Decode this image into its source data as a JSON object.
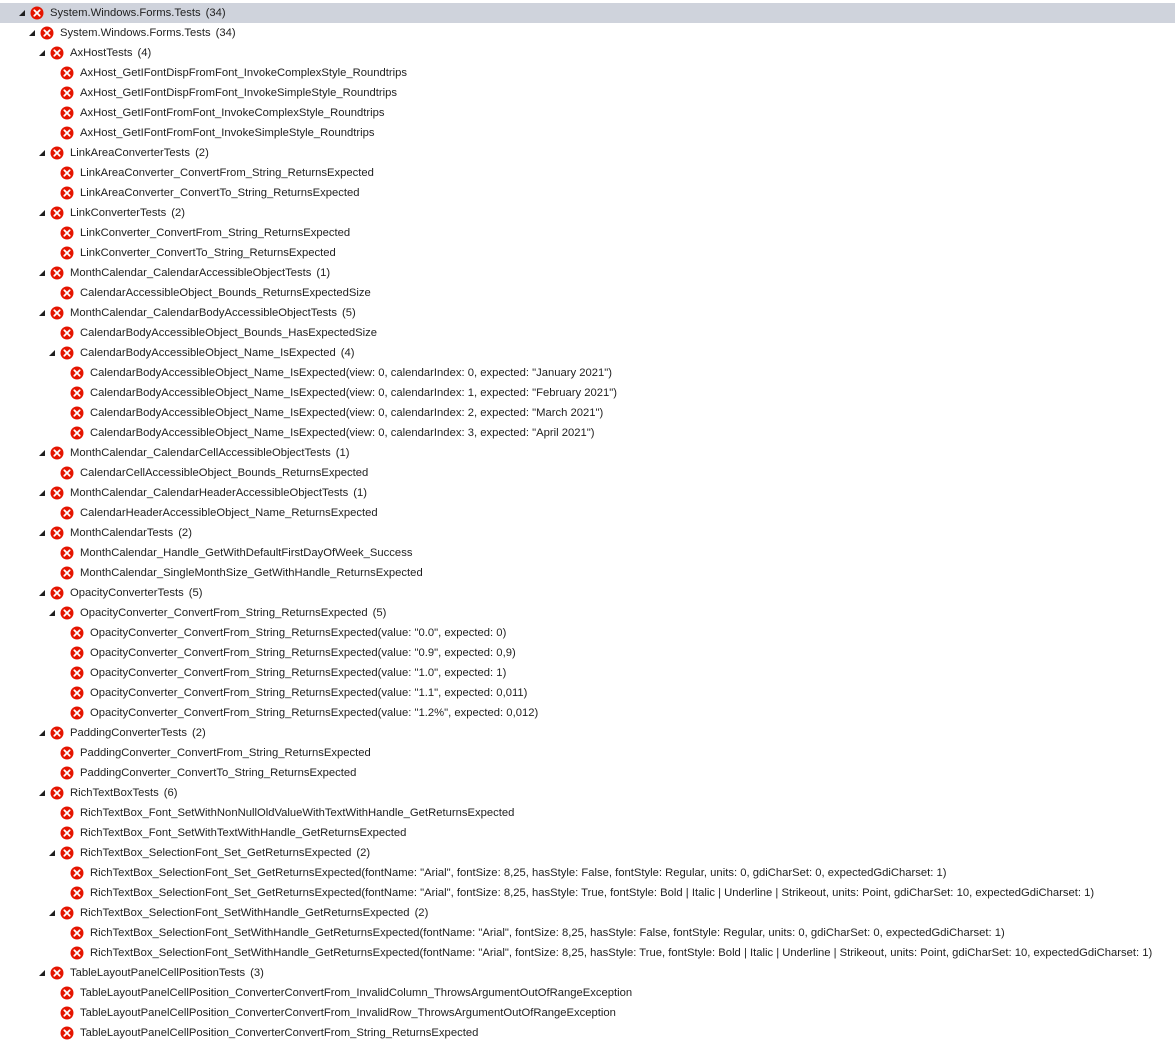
{
  "colors": {
    "failed_icon": "#e51400",
    "selection": "#cfd3dc",
    "expander": "#1e1e1e",
    "text": "#1e1e1e"
  },
  "icons": {
    "expander": "expanded-triangle-icon",
    "status": "failed-x-icon"
  },
  "tree": [
    {
      "level": 0,
      "expanded": true,
      "selected": true,
      "label": "System.Windows.Forms.Tests",
      "count": "(34)"
    },
    {
      "level": 1,
      "expanded": true,
      "label": "System.Windows.Forms.Tests",
      "count": "(34)"
    },
    {
      "level": 2,
      "expanded": true,
      "label": "AxHostTests",
      "count": "(4)"
    },
    {
      "level": 3,
      "label": "AxHost_GetIFontDispFromFont_InvokeComplexStyle_Roundtrips"
    },
    {
      "level": 3,
      "label": "AxHost_GetIFontDispFromFont_InvokeSimpleStyle_Roundtrips"
    },
    {
      "level": 3,
      "label": "AxHost_GetIFontFromFont_InvokeComplexStyle_Roundtrips"
    },
    {
      "level": 3,
      "label": "AxHost_GetIFontFromFont_InvokeSimpleStyle_Roundtrips"
    },
    {
      "level": 2,
      "expanded": true,
      "label": "LinkAreaConverterTests",
      "count": "(2)"
    },
    {
      "level": 3,
      "label": "LinkAreaConverter_ConvertFrom_String_ReturnsExpected"
    },
    {
      "level": 3,
      "label": "LinkAreaConverter_ConvertTo_String_ReturnsExpected"
    },
    {
      "level": 2,
      "expanded": true,
      "label": "LinkConverterTests",
      "count": "(2)"
    },
    {
      "level": 3,
      "label": "LinkConverter_ConvertFrom_String_ReturnsExpected"
    },
    {
      "level": 3,
      "label": "LinkConverter_ConvertTo_String_ReturnsExpected"
    },
    {
      "level": 2,
      "expanded": true,
      "label": "MonthCalendar_CalendarAccessibleObjectTests",
      "count": "(1)"
    },
    {
      "level": 3,
      "label": "CalendarAccessibleObject_Bounds_ReturnsExpectedSize"
    },
    {
      "level": 2,
      "expanded": true,
      "label": "MonthCalendar_CalendarBodyAccessibleObjectTests",
      "count": "(5)"
    },
    {
      "level": 3,
      "label": "CalendarBodyAccessibleObject_Bounds_HasExpectedSize"
    },
    {
      "level": 3,
      "expanded": true,
      "label": "CalendarBodyAccessibleObject_Name_IsExpected",
      "count": "(4)"
    },
    {
      "level": 4,
      "label": "CalendarBodyAccessibleObject_Name_IsExpected(view: 0, calendarIndex: 0, expected: \"January 2021\")"
    },
    {
      "level": 4,
      "label": "CalendarBodyAccessibleObject_Name_IsExpected(view: 0, calendarIndex: 1, expected: \"February 2021\")"
    },
    {
      "level": 4,
      "label": "CalendarBodyAccessibleObject_Name_IsExpected(view: 0, calendarIndex: 2, expected: \"March 2021\")"
    },
    {
      "level": 4,
      "label": "CalendarBodyAccessibleObject_Name_IsExpected(view: 0, calendarIndex: 3, expected: \"April 2021\")"
    },
    {
      "level": 2,
      "expanded": true,
      "label": "MonthCalendar_CalendarCellAccessibleObjectTests",
      "count": "(1)"
    },
    {
      "level": 3,
      "label": "CalendarCellAccessibleObject_Bounds_ReturnsExpected"
    },
    {
      "level": 2,
      "expanded": true,
      "label": "MonthCalendar_CalendarHeaderAccessibleObjectTests",
      "count": "(1)"
    },
    {
      "level": 3,
      "label": "CalendarHeaderAccessibleObject_Name_ReturnsExpected"
    },
    {
      "level": 2,
      "expanded": true,
      "label": "MonthCalendarTests",
      "count": "(2)"
    },
    {
      "level": 3,
      "label": "MonthCalendar_Handle_GetWithDefaultFirstDayOfWeek_Success"
    },
    {
      "level": 3,
      "label": "MonthCalendar_SingleMonthSize_GetWithHandle_ReturnsExpected"
    },
    {
      "level": 2,
      "expanded": true,
      "label": "OpacityConverterTests",
      "count": "(5)"
    },
    {
      "level": 3,
      "expanded": true,
      "label": "OpacityConverter_ConvertFrom_String_ReturnsExpected",
      "count": "(5)"
    },
    {
      "level": 4,
      "label": "OpacityConverter_ConvertFrom_String_ReturnsExpected(value: \"0.0\", expected: 0)"
    },
    {
      "level": 4,
      "label": "OpacityConverter_ConvertFrom_String_ReturnsExpected(value: \"0.9\", expected: 0,9)"
    },
    {
      "level": 4,
      "label": "OpacityConverter_ConvertFrom_String_ReturnsExpected(value: \"1.0\", expected: 1)"
    },
    {
      "level": 4,
      "label": "OpacityConverter_ConvertFrom_String_ReturnsExpected(value: \"1.1\", expected: 0,011)"
    },
    {
      "level": 4,
      "label": "OpacityConverter_ConvertFrom_String_ReturnsExpected(value: \"1.2%\", expected: 0,012)"
    },
    {
      "level": 2,
      "expanded": true,
      "label": "PaddingConverterTests",
      "count": "(2)"
    },
    {
      "level": 3,
      "label": "PaddingConverter_ConvertFrom_String_ReturnsExpected"
    },
    {
      "level": 3,
      "label": "PaddingConverter_ConvertTo_String_ReturnsExpected"
    },
    {
      "level": 2,
      "expanded": true,
      "label": "RichTextBoxTests",
      "count": "(6)"
    },
    {
      "level": 3,
      "label": "RichTextBox_Font_SetWithNonNullOldValueWithTextWithHandle_GetReturnsExpected"
    },
    {
      "level": 3,
      "label": "RichTextBox_Font_SetWithTextWithHandle_GetReturnsExpected"
    },
    {
      "level": 3,
      "expanded": true,
      "label": "RichTextBox_SelectionFont_Set_GetReturnsExpected",
      "count": "(2)"
    },
    {
      "level": 4,
      "label": "RichTextBox_SelectionFont_Set_GetReturnsExpected(fontName: \"Arial\", fontSize: 8,25, hasStyle: False, fontStyle: Regular, units: 0, gdiCharSet: 0, expectedGdiCharset: 1)"
    },
    {
      "level": 4,
      "label": "RichTextBox_SelectionFont_Set_GetReturnsExpected(fontName: \"Arial\", fontSize: 8,25, hasStyle: True, fontStyle: Bold | Italic | Underline | Strikeout, units: Point, gdiCharSet: 10, expectedGdiCharset: 1)"
    },
    {
      "level": 3,
      "expanded": true,
      "label": "RichTextBox_SelectionFont_SetWithHandle_GetReturnsExpected",
      "count": "(2)"
    },
    {
      "level": 4,
      "label": "RichTextBox_SelectionFont_SetWithHandle_GetReturnsExpected(fontName: \"Arial\", fontSize: 8,25, hasStyle: False, fontStyle: Regular, units: 0, gdiCharSet: 0, expectedGdiCharset: 1)"
    },
    {
      "level": 4,
      "label": "RichTextBox_SelectionFont_SetWithHandle_GetReturnsExpected(fontName: \"Arial\", fontSize: 8,25, hasStyle: True, fontStyle: Bold | Italic | Underline | Strikeout, units: Point, gdiCharSet: 10, expectedGdiCharset: 1)"
    },
    {
      "level": 2,
      "expanded": true,
      "label": "TableLayoutPanelCellPositionTests",
      "count": "(3)"
    },
    {
      "level": 3,
      "label": "TableLayoutPanelCellPosition_ConverterConvertFrom_InvalidColumn_ThrowsArgumentOutOfRangeException"
    },
    {
      "level": 3,
      "label": "TableLayoutPanelCellPosition_ConverterConvertFrom_InvalidRow_ThrowsArgumentOutOfRangeException"
    },
    {
      "level": 3,
      "label": "TableLayoutPanelCellPosition_ConverterConvertFrom_String_ReturnsExpected"
    }
  ]
}
